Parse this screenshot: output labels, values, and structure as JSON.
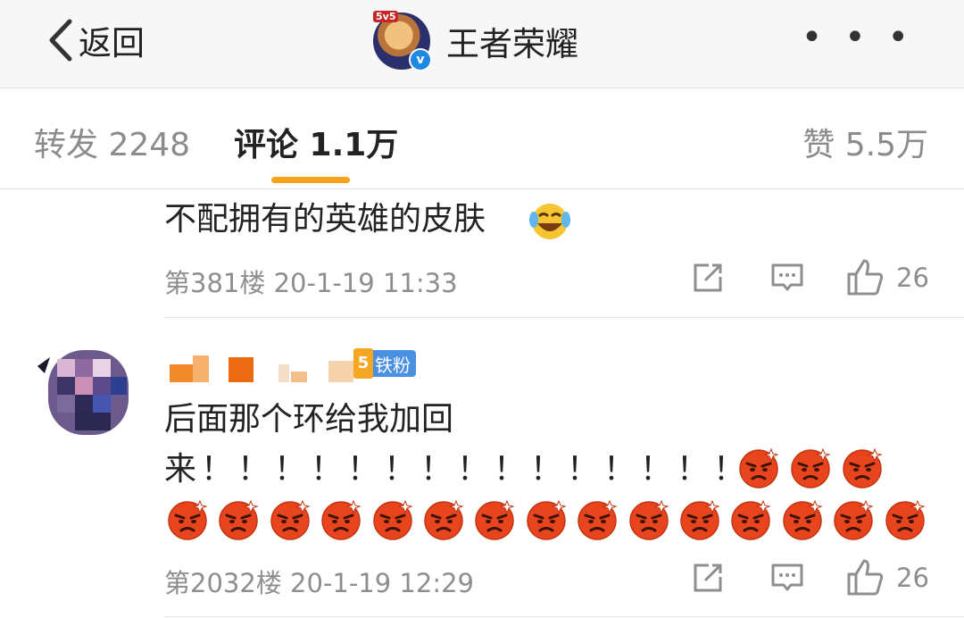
{
  "header": {
    "back_label": "返回",
    "title": "王者荣耀",
    "avatar_tag": "5v5",
    "verified_mark": "v",
    "more_label": "• • •"
  },
  "tabs": {
    "repost": "转发 2248",
    "comment": "评论 1.1万",
    "like": "赞 5.5万",
    "accent_color": "#f6a21a"
  },
  "comments": [
    {
      "text": "不配拥有的英雄的皮肤",
      "emoji": "crying-laughing",
      "floor": "第381楼",
      "time": "20-1-19 11:33",
      "likes": "26"
    },
    {
      "badge_level": "5",
      "badge_label": "铁粉",
      "line1": "后面那个环给我加回",
      "line2": "来！！！！！！！！！！！！！！！",
      "emoji": "angry-face",
      "emoji_count": 18,
      "floor": "第2032楼",
      "time": "20-1-19 12:29",
      "likes": "26"
    }
  ]
}
